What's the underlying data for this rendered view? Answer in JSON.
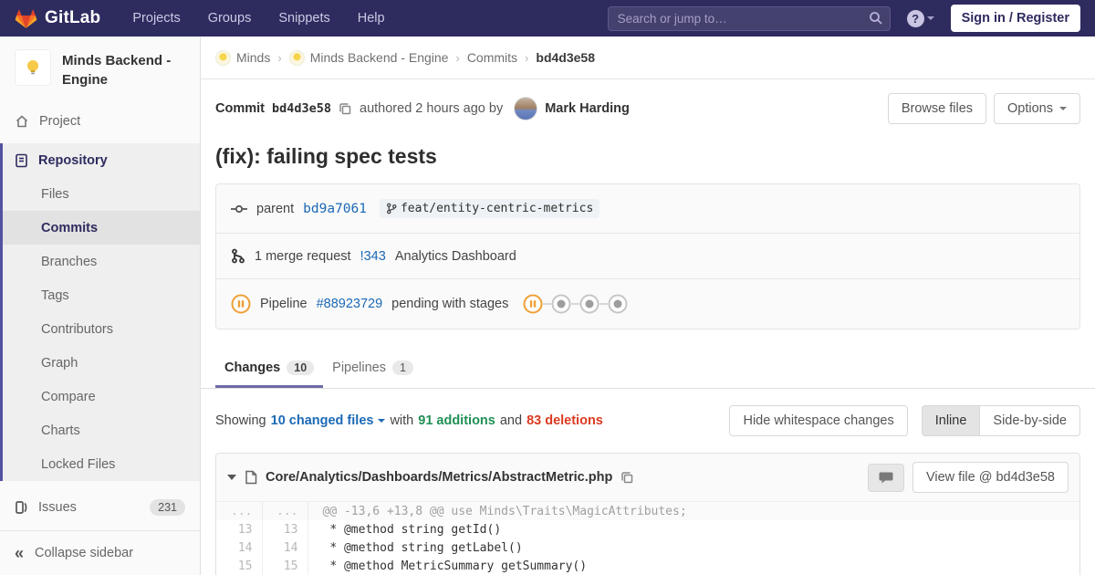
{
  "navbar": {
    "brand": "GitLab",
    "items": {
      "projects": "Projects",
      "groups": "Groups",
      "snippets": "Snippets",
      "help": "Help"
    },
    "search_placeholder": "Search or jump to…",
    "help_glyph": "?",
    "sign_in": "Sign in / Register"
  },
  "sidebar": {
    "project_title": "Minds Backend - Engine",
    "project": "Project",
    "repository": "Repository",
    "repo_items": [
      "Files",
      "Commits",
      "Branches",
      "Tags",
      "Contributors",
      "Graph",
      "Compare",
      "Charts",
      "Locked Files"
    ],
    "issues": "Issues",
    "issues_count": "231",
    "collapse": "Collapse sidebar",
    "collapse_glyph": "«"
  },
  "breadcrumb": {
    "items": [
      "Minds",
      "Minds Backend - Engine",
      "Commits",
      "bd4d3e58"
    ],
    "separator": "›"
  },
  "commit": {
    "label": "Commit",
    "sha": "bd4d3e58",
    "authored_text": "authored 2 hours ago by",
    "author": "Mark Harding",
    "browse_files": "Browse files",
    "options": "Options",
    "title": "(fix): failing spec tests",
    "parent_label": "parent",
    "parent_sha": "bd9a7061",
    "branch_ref": "feat/entity-centric-metrics",
    "mr_text": "1 merge request",
    "mr_ref": "!343",
    "mr_name": "Analytics Dashboard",
    "pipeline_label": "Pipeline",
    "pipeline_id": "#88923729",
    "pipeline_status_text": "pending with stages"
  },
  "tabs": {
    "changes": {
      "label": "Changes",
      "count": "10"
    },
    "pipelines": {
      "label": "Pipelines",
      "count": "1"
    }
  },
  "diff_controls": {
    "showing": "Showing",
    "changed_files": "10 changed files",
    "with": "with",
    "additions": "91 additions",
    "and": "and",
    "deletions": "83 deletions",
    "hide_whitespace": "Hide whitespace changes",
    "inline": "Inline",
    "side_by_side": "Side-by-side"
  },
  "file": {
    "path": "Core/Analytics/Dashboards/Metrics/AbstractMetric.php",
    "view_file": "View file @ bd4d3e58",
    "diff": [
      {
        "old": "...",
        "new": "...",
        "text": "@@ -13,6 +13,8 @@ use Minds\\Traits\\MagicAttributes;"
      },
      {
        "old": "13",
        "new": "13",
        "text": " * @method string getId()"
      },
      {
        "old": "14",
        "new": "14",
        "text": " * @method string getLabel()"
      },
      {
        "old": "15",
        "new": "15",
        "text": " * @method MetricSummary getSummary()"
      }
    ]
  },
  "colors": {
    "navbar_bg": "#2e2b5f",
    "accent_purple": "#5452a0",
    "link_blue": "#1b69b6",
    "additions_green": "#218f55",
    "deletions_red": "#db3b21",
    "pipeline_pending_orange": "#ef9f36"
  }
}
